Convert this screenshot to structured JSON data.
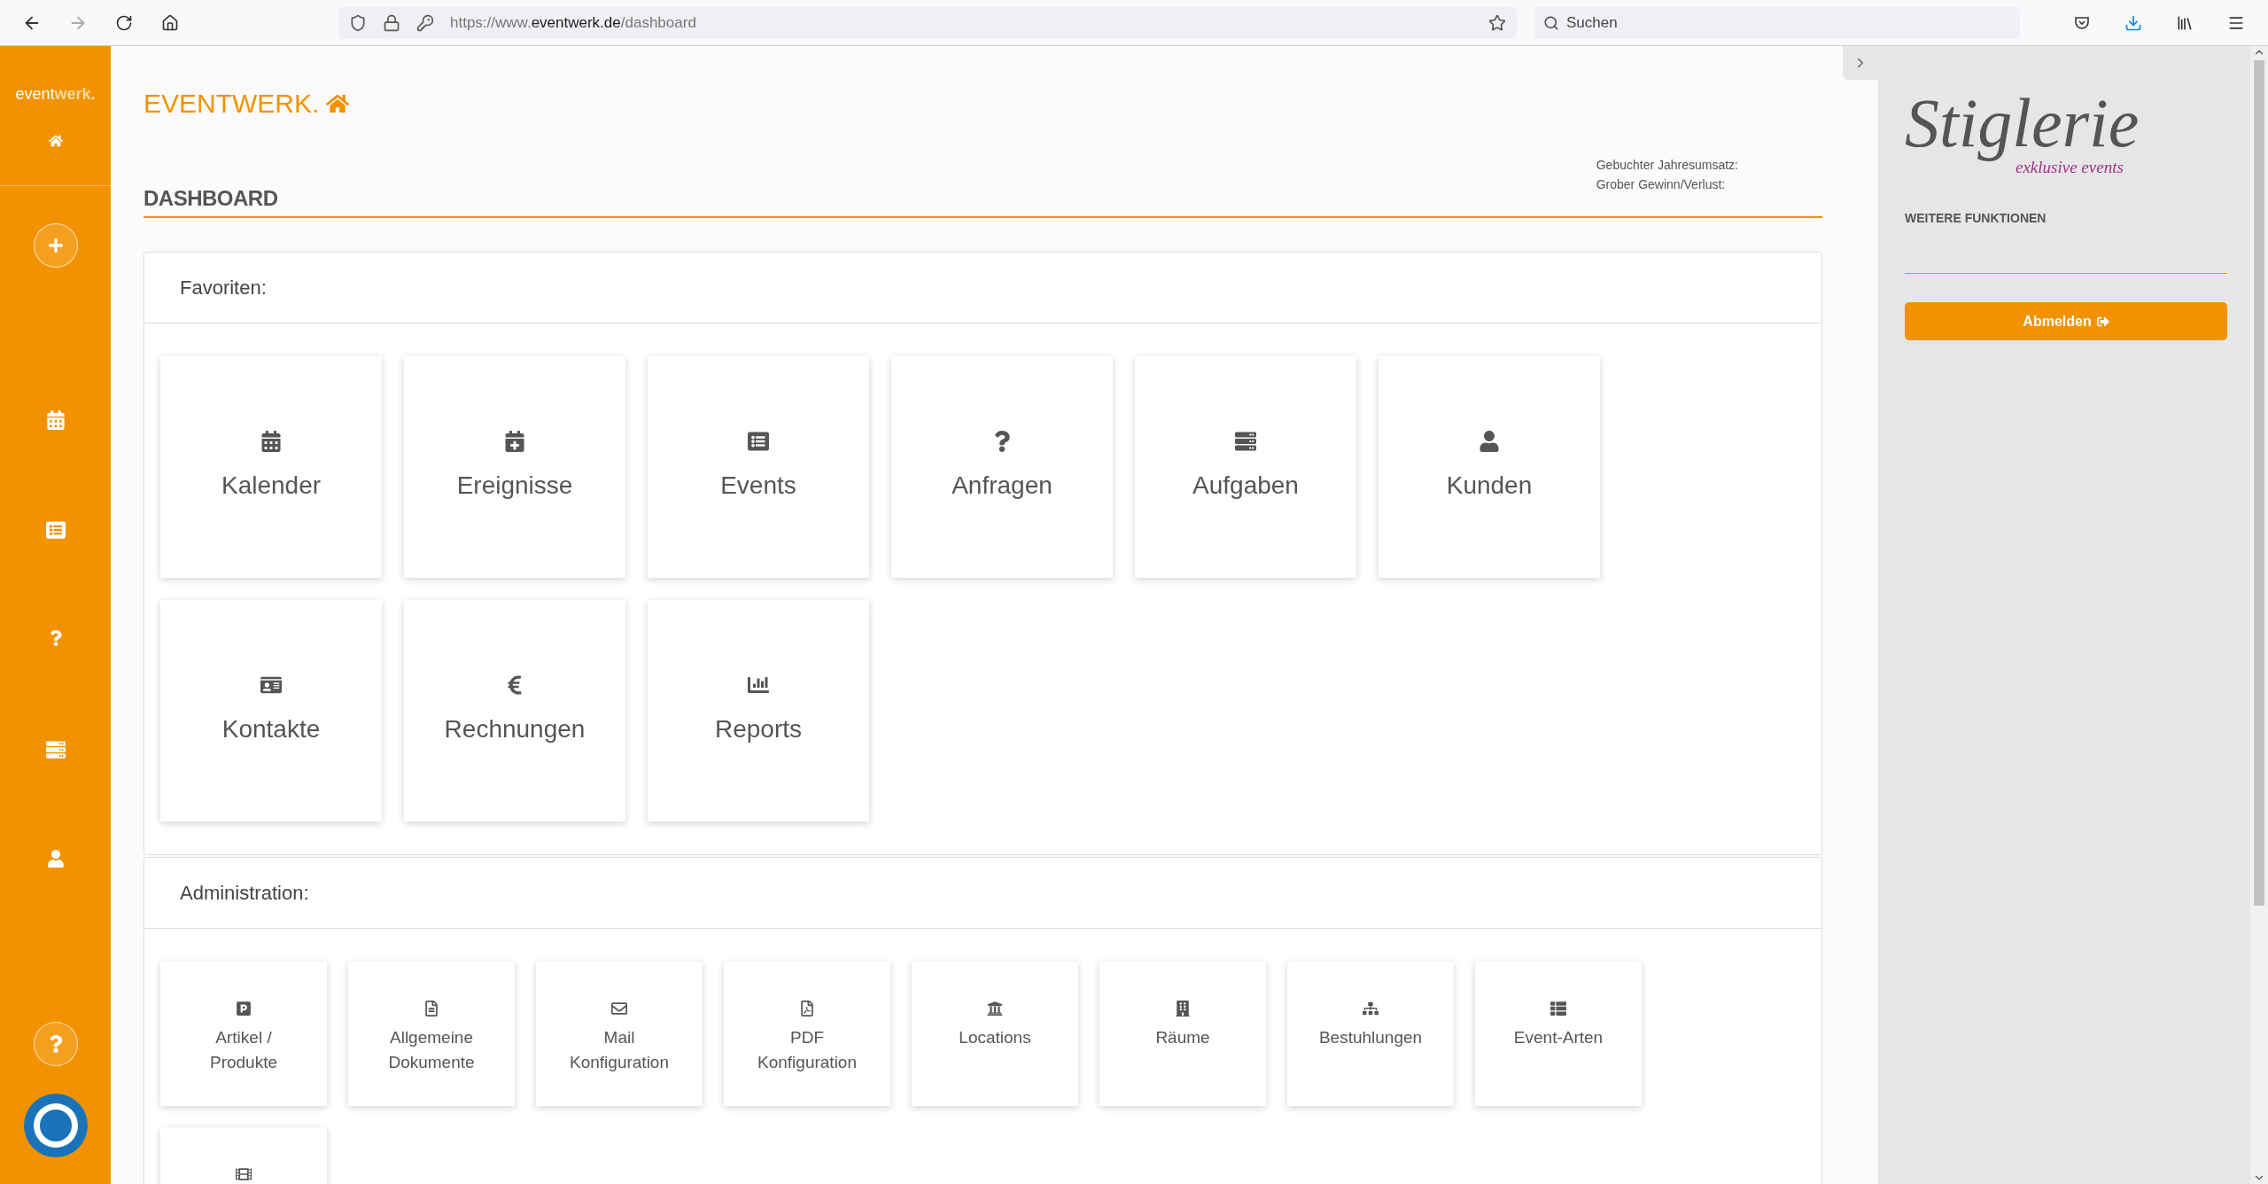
{
  "browser": {
    "url": {
      "prefix": "https://www.",
      "domain": "eventwerk.de",
      "path": "/dashboard"
    },
    "search": {
      "placeholder": "Suchen"
    }
  },
  "sidebar": {
    "logo": [
      "event",
      "werk."
    ]
  },
  "header": {
    "brand": "EVENTWERK.",
    "stats": [
      "Gebuchter Jahresumsatz:",
      "Grober Gewinn/Verlust:"
    ],
    "title": "DASHBOARD"
  },
  "sections": [
    {
      "title": "Favoriten:",
      "kind": "large",
      "tiles": [
        {
          "label": "Kalender"
        },
        {
          "label": "Ereignisse"
        },
        {
          "label": "Events"
        },
        {
          "label": "Anfragen"
        },
        {
          "label": "Aufgaben"
        },
        {
          "label": "Kunden"
        },
        {
          "label": "Kontakte"
        },
        {
          "label": "Rechnungen"
        },
        {
          "label": "Reports"
        }
      ]
    },
    {
      "title": "Administration:",
      "kind": "small",
      "tiles": [
        {
          "label": "Artikel /\nProdukte"
        },
        {
          "label": "Allgemeine\nDokumente"
        },
        {
          "label": "Mail\nKonfiguration"
        },
        {
          "label": "PDF\nKonfiguration"
        },
        {
          "label": "Locations"
        },
        {
          "label": "Räume"
        },
        {
          "label": "Bestuhlungen"
        },
        {
          "label": "Event-Arten"
        }
      ],
      "unlabeled_tile_cut_off": true
    }
  ],
  "panel": {
    "logo": "Stiglerie",
    "tagline": "exklusive events",
    "heading": "WEITERE FUNKTIONEN",
    "logout": "Abmelden"
  }
}
